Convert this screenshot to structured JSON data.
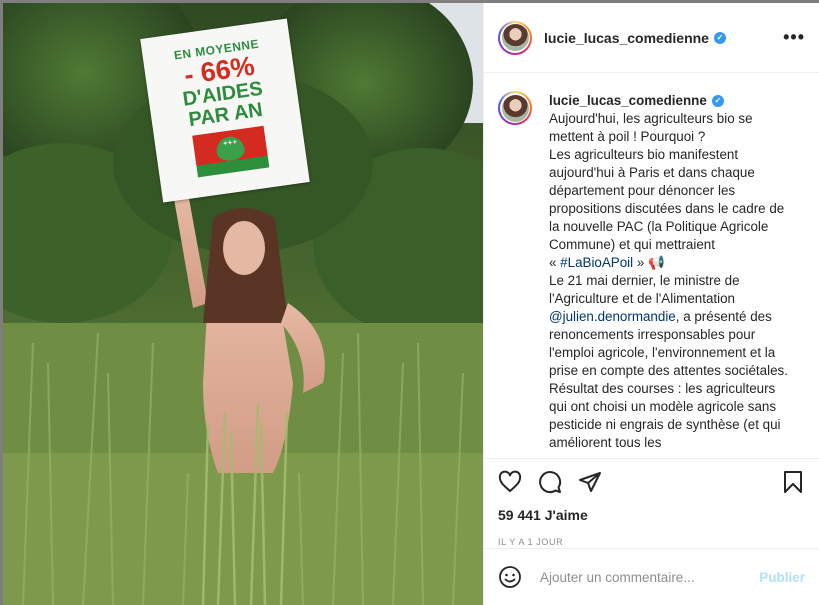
{
  "post": {
    "username": "lucie_lucas_comedienne",
    "more_icon": "more-horizontal-icon",
    "verified_icon": "verified-badge-icon"
  },
  "sign": {
    "line1": "EN MOYENNE",
    "line2": "- 66%",
    "line3": "D'AIDES",
    "line4": "PAR AN"
  },
  "caption": {
    "username": "lucie_lucas_comedienne",
    "p1": "Aujourd'hui, les agriculteurs bio se mettent à poil ! Pourquoi ?",
    "p2": "Les agriculteurs bio manifestent aujourd'hui à Paris et dans chaque département pour dénoncer les propositions discutées dans le cadre de la nouvelle PAC (la Politique Agricole Commune) et qui mettraient",
    "p3_prefix": "« ",
    "hashtag": "#LaBioAPoil",
    "p3_suffix": " » 📢",
    "p4_text": "Le 21 mai dernier, le ministre de l'Agriculture et de l'Alimentation ",
    "mention": "@julien.denormandie",
    "p4_rest": ", a présenté des renoncements irresponsables pour l'emploi agricole, l'environnement et la prise en compte des attentes sociétales. Résultat des courses : les agriculteurs qui ont choisi un modèle agricole sans pesticide ni engrais de synthèse (et qui améliorent tous les"
  },
  "actions": {
    "like_icon": "heart-icon",
    "comment_icon": "comment-icon",
    "share_icon": "share-icon",
    "save_icon": "bookmark-icon",
    "likes": "59 441 J'aime",
    "timestamp": "IL Y A 1 JOUR"
  },
  "comment_form": {
    "emoji_icon": "emoji-icon",
    "placeholder": "Ajouter un commentaire...",
    "publish_label": "Publier"
  },
  "colors": {
    "accent": "#3897f0",
    "link": "#00376b",
    "publish_disabled": "#b2dffc",
    "sign_green": "#2e8b3e",
    "sign_red": "#d62b1e"
  }
}
